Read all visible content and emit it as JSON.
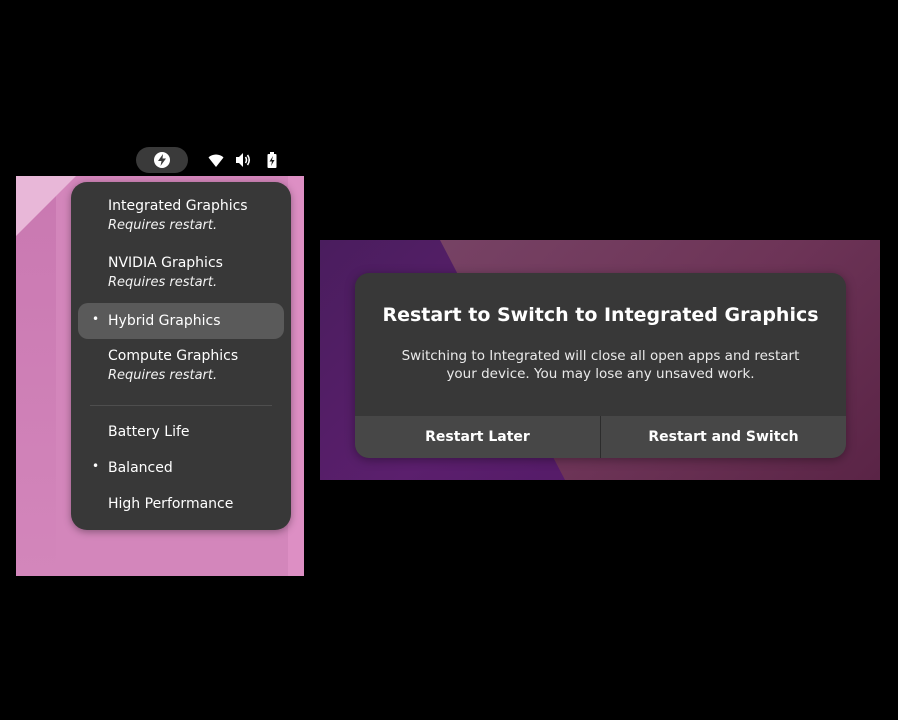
{
  "topbar": {
    "indicators": [
      {
        "icon": "power-profile-icon"
      },
      {
        "icon": "wifi-icon"
      },
      {
        "icon": "volume-icon"
      },
      {
        "icon": "battery-charging-icon"
      }
    ]
  },
  "graphics_menu": {
    "items": [
      {
        "label": "Integrated Graphics",
        "sublabel": "Requires restart.",
        "selected": false
      },
      {
        "label": "NVIDIA Graphics",
        "sublabel": "Requires restart.",
        "selected": false
      },
      {
        "label": "Hybrid Graphics",
        "sublabel": "",
        "selected": true,
        "bullet": "•"
      },
      {
        "label": "Compute Graphics",
        "sublabel": "Requires restart.",
        "selected": false
      }
    ]
  },
  "power_menu": {
    "items": [
      {
        "label": "Battery Life",
        "selected": false
      },
      {
        "label": "Balanced",
        "selected": true,
        "bullet": "•"
      },
      {
        "label": "High Performance",
        "selected": false
      }
    ]
  },
  "dialog": {
    "title": "Restart to Switch to Integrated Graphics",
    "body": "Switching to Integrated will close all open apps and restart your device. You may lose any unsaved work.",
    "cancel_label": "Restart Later",
    "confirm_label": "Restart and Switch"
  },
  "colors": {
    "popover_bg": "#383838",
    "selected_bg": "#5a5a5a",
    "dialog_bg": "#383838",
    "button_bg": "#474747",
    "wallpaper_pink": "#d386bb",
    "wallpaper_purple": "#5b1f6d"
  }
}
